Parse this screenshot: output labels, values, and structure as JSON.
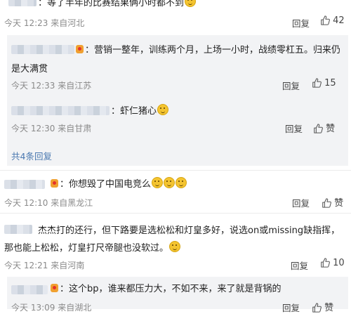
{
  "comments": [
    {
      "text": "：等了半年的比赛结果俩小时都不到",
      "time": "今天 12:23 来自河北",
      "reply_label": "回复",
      "likes": "42"
    },
    {
      "text": "：营销一整年，训练两个月，上场一小时，战绩零杠五。归来仍是大满贯",
      "time": "今天 12:33 来自江苏",
      "reply_label": "回复",
      "likes": "15"
    },
    {
      "text": "：虾仁猪心",
      "time": "今天 12:30 来自甘肃",
      "reply_label": "回复",
      "likes": "赞"
    },
    {
      "text": "：你想毁了中国电竞么",
      "time": "今天 12:10 来自黑龙江",
      "reply_label": "回复",
      "likes": "赞"
    },
    {
      "text": "杰杰打的还行，但下路要是选松松和灯皇多好，说选on或missing缺指挥，那也能上松松，灯皇打尺帝腿也没软过。",
      "time": "今天 12:21 来自河南",
      "reply_label": "回复",
      "likes": "10"
    },
    {
      "text": "：这个bp，谁来都压力大，不如不来，来了就是背锅的",
      "time": "今天 13:09 来自湖北",
      "reply_label": "回复",
      "likes": "赞"
    }
  ],
  "expand_replies": "共4条回复",
  "icons": {
    "thumb": "thumbs-up-icon",
    "badge": "fan-badge-icon",
    "emoji": "smiley-emoji-icon"
  },
  "colors": {
    "link": "#4a78b0",
    "meta": "#8a8a8a",
    "reply_bg": "#f2f3f5"
  }
}
